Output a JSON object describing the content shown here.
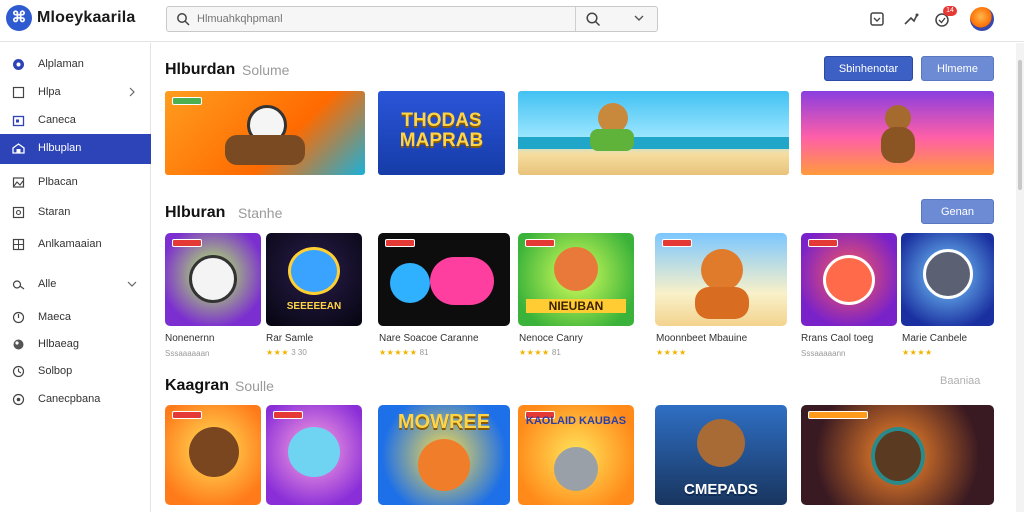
{
  "app": {
    "brand": "Mloeykaarila",
    "logo_glyph": "⌘"
  },
  "search": {
    "placeholder": "Hlmuahkqhpmanl"
  },
  "topbar": {
    "notification_count": "14"
  },
  "sidebar": {
    "items": [
      {
        "label": "Alplaman",
        "icon": "home-icon"
      },
      {
        "label": "Hlpa",
        "icon": "bookmark-icon",
        "chevron": true
      },
      {
        "label": "Caneca",
        "icon": "calendar-icon"
      },
      {
        "label": "Hlbuplan",
        "icon": "gamepad-icon",
        "active": true
      },
      {
        "label": "Plbacan",
        "icon": "image-icon"
      },
      {
        "label": "Staran",
        "icon": "monitor-icon"
      },
      {
        "label": "Anlkamaaian",
        "icon": "apps-icon"
      },
      {
        "label": "Alle",
        "icon": "link-icon",
        "chevron": true
      },
      {
        "label": "Maeca",
        "icon": "compass-icon"
      },
      {
        "label": "Hlbaeag",
        "icon": "globe-icon"
      },
      {
        "label": "Solbop",
        "icon": "clock-icon"
      },
      {
        "label": "Canecpbana",
        "icon": "settings-icon"
      }
    ]
  },
  "sections": [
    {
      "title": "Hlburdan",
      "subtitle": "Solume",
      "buttons": [
        "Sbinhenotar",
        "Hlmeme"
      ]
    },
    {
      "title": "Hlburan",
      "subtitle": "Stanhe",
      "buttons": [
        "Genan"
      ]
    },
    {
      "title": "Kaagran",
      "subtitle": "Soulle",
      "link": "Baaniaa"
    }
  ],
  "banners": [
    {
      "text": ""
    },
    {
      "text": "THODAS MAPRAB"
    },
    {
      "text": ""
    },
    {
      "text": ""
    }
  ],
  "games": [
    {
      "name": "Nonenernn",
      "rating": "Sssaaaaaan",
      "stars": ""
    },
    {
      "name": "Rar Samle",
      "rating": "3 30",
      "stars": "★★★"
    },
    {
      "name": "Nare Soacoe Caranne",
      "rating": "81",
      "stars": "★★★★★"
    },
    {
      "name": "Nenoce Canry",
      "rating": "81",
      "stars": "★★★★"
    },
    {
      "name": "Moonnbeet Mbauine",
      "rating": "",
      "stars": "★★★★"
    },
    {
      "name": "Rrans Caol toeg",
      "rating": "Sssaaaaann",
      "stars": ""
    },
    {
      "name": "Marie Canbele",
      "rating": "",
      "stars": "★★★★"
    }
  ],
  "tile_texts": {
    "r2_t2": "SEEEEEAN",
    "r2_t4": "NIEUBAN",
    "r3_t3": "MOWREE",
    "r3_t4": "KAOLAID KAUBAS",
    "r3_t5": "CMEPADS"
  },
  "colors": {
    "accent": "#2d43b8",
    "button": "#3c60c4",
    "badge": "#e53935",
    "stars": "#f0b400"
  }
}
